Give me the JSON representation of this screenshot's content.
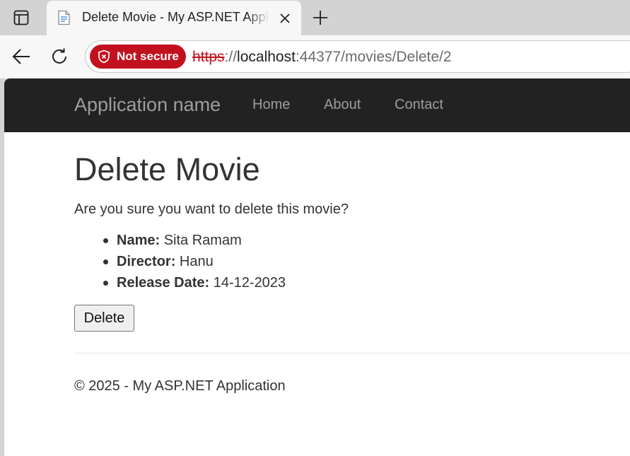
{
  "browser": {
    "tab": {
      "title": "Delete Movie - My ASP.NET Application"
    },
    "address_bar": {
      "security_label": "Not secure",
      "url_scheme": "https",
      "url_separator": "://",
      "url_host": "localhost",
      "url_rest": ":44377/movies/Delete/2"
    },
    "icons": [
      "tab-actions-icon",
      "page-favicon-icon",
      "close-icon",
      "plus-icon",
      "back-arrow-icon",
      "refresh-icon",
      "shield-icon"
    ]
  },
  "site": {
    "brand": "Application name",
    "nav": {
      "home": "Home",
      "about": "About",
      "contact": "Contact"
    }
  },
  "page": {
    "heading": "Delete Movie",
    "confirm_text": "Are you sure you want to delete this movie?",
    "movie": {
      "name_label": "Name:",
      "name": "Sita Ramam",
      "director_label": "Director:",
      "director": "Hanu",
      "release_label": "Release Date:",
      "release_date": "14-12-2023"
    },
    "delete_button": "Delete",
    "footer": "© 2025 - My ASP.NET Application"
  },
  "colors": {
    "navbar_bg": "#222222",
    "nav_text": "#9d9d9d",
    "not_secure": "#c3101e",
    "body_text": "#333333"
  }
}
